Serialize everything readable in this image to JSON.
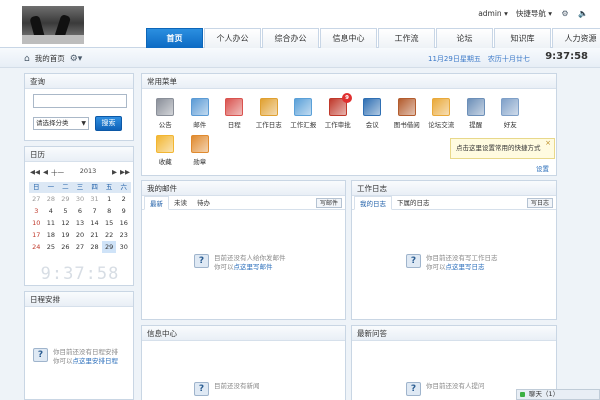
{
  "header": {
    "user": "admin ▾",
    "quicknav": "快捷导航 ▾",
    "icons": [
      "gear-icon",
      "volume-icon"
    ]
  },
  "nav": {
    "tabs": [
      "首页",
      "个人办公",
      "综合办公",
      "信息中心",
      "工作流",
      "论坛",
      "知识库",
      "人力资源"
    ],
    "active": "首页"
  },
  "breadcrumb": {
    "home": "我的首页",
    "date": "11月29日星期五　农历十月廿七",
    "time": "9:37:58"
  },
  "search": {
    "title": "查询",
    "input_value": "",
    "select_value": "请选择分类",
    "button": "搜索"
  },
  "calendar": {
    "title": "日历",
    "month": "十一",
    "year": "2013",
    "weekdays": [
      "日",
      "一",
      "二",
      "三",
      "四",
      "五",
      "六"
    ],
    "days": [
      [
        "27",
        "28",
        "29",
        "30",
        "31",
        "1",
        "2"
      ],
      [
        "3",
        "4",
        "5",
        "6",
        "7",
        "8",
        "9"
      ],
      [
        "10",
        "11",
        "12",
        "13",
        "14",
        "15",
        "16"
      ],
      [
        "17",
        "18",
        "19",
        "20",
        "21",
        "22",
        "23"
      ],
      [
        "24",
        "25",
        "26",
        "27",
        "28",
        "29",
        "30"
      ]
    ],
    "today": "29",
    "clock": "9:37:58"
  },
  "schedule": {
    "title": "日程安排",
    "empty_line1": "你目前还没有日程安排",
    "empty_prefix": "你可以",
    "empty_link": "点这里安排日程"
  },
  "common_menu": {
    "title": "常用菜单",
    "items": [
      {
        "label": "公告",
        "icon": "notice-icon",
        "color": "#8a8f99"
      },
      {
        "label": "邮件",
        "icon": "mail-icon",
        "color": "#5b9bd5"
      },
      {
        "label": "日程",
        "icon": "calendar-icon",
        "color": "#d9534f"
      },
      {
        "label": "工作日志",
        "icon": "worklog-icon",
        "color": "#e0a030"
      },
      {
        "label": "工作汇报",
        "icon": "report-icon",
        "color": "#5aa0d8"
      },
      {
        "label": "工作审批",
        "icon": "approval-icon",
        "color": "#c0392b",
        "badge": "9"
      },
      {
        "label": "会议",
        "icon": "meeting-icon",
        "color": "#2f6fb3"
      },
      {
        "label": "图书借阅",
        "icon": "books-icon",
        "color": "#b35c2e"
      },
      {
        "label": "论坛交流",
        "icon": "forum-icon",
        "color": "#e9a93a"
      },
      {
        "label": "提醒",
        "icon": "speaker-icon",
        "color": "#6c8fb8"
      },
      {
        "label": "好友",
        "icon": "friends-icon",
        "color": "#7fa0c8"
      },
      {
        "label": "收藏",
        "icon": "star-icon",
        "color": "#f2b632"
      },
      {
        "label": "勋章",
        "icon": "medal-icon",
        "color": "#e08a2e"
      }
    ],
    "tip": "点击这里设置常用的快捷方式",
    "tip_close": "×",
    "settings_link": "设置"
  },
  "mail": {
    "title": "我的邮件",
    "tabs": [
      "最新",
      "未读",
      "待办"
    ],
    "write_button": "写邮件",
    "empty_line1": "目前还没有人给你发邮件",
    "empty_prefix": "你可以",
    "empty_link": "点这里写邮件"
  },
  "worklog": {
    "title": "工作日志",
    "tabs": [
      "我的日志",
      "下属的日志"
    ],
    "write_button": "写日志",
    "empty_line1": "你目前还没有写工作日志",
    "empty_prefix": "你可以",
    "empty_link": "点这里写日志"
  },
  "news": {
    "title": "信息中心",
    "empty_line1": "目前还没有新闻"
  },
  "qa": {
    "title": "最新问答",
    "empty_line1": "你目前还没有人提问"
  },
  "chat": {
    "label": "聊天（1）"
  }
}
